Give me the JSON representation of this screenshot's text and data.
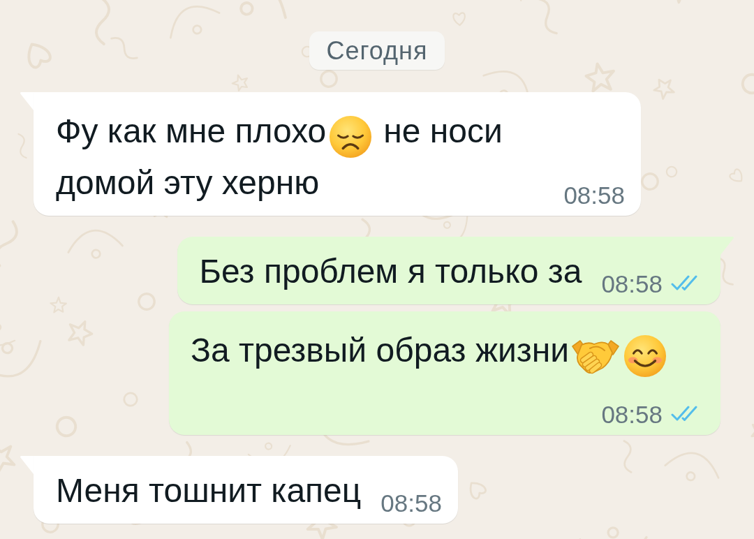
{
  "date_chip": {
    "label": "Сегодня"
  },
  "messages": [
    {
      "kind": "incoming",
      "tail": true,
      "segments": [
        {
          "kind": "text",
          "text": "Фу как мне плохо"
        },
        {
          "kind": "sad_face"
        },
        {
          "kind": "text",
          "text": "не носи"
        },
        {
          "kind": "text",
          "text": "домой эту херню"
        }
      ],
      "time": "08:58"
    },
    {
      "kind": "outgoing",
      "tail": true,
      "segments": [
        {
          "kind": "text",
          "text": "Без проблем я только за"
        }
      ],
      "time": "08:58",
      "read": true
    },
    {
      "kind": "outgoing",
      "tail": false,
      "segments": [
        {
          "kind": "text",
          "text": "За трезвый образ жизни"
        },
        {
          "kind": "handshake"
        },
        {
          "kind": "smiling_face"
        }
      ],
      "time": "08:58",
      "read": true
    },
    {
      "kind": "incoming",
      "tail": true,
      "segments": [
        {
          "kind": "text",
          "text": "Меня тошнит капец"
        }
      ],
      "time": "08:58"
    }
  ]
}
